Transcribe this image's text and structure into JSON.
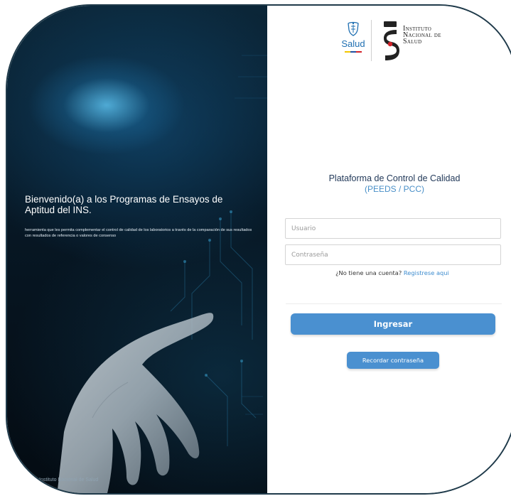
{
  "left_panel": {
    "welcome_title": "Bienvenido(a) a los Programas de Ensayos de Aptitud del INS.",
    "welcome_description": "herramienta que les permita complementar el control de calidad de los laboratorios a través de la comparación de sus resultados con resultados de referencia o valores de consenso",
    "footer": "Instituto Nacional de Salud"
  },
  "logos": {
    "salud_label": "Salud",
    "ins_line1": "Instituto",
    "ins_line2": "Nacional de",
    "ins_line3": "Salud"
  },
  "login": {
    "title": "Plataforma de Control de Calidad",
    "subtitle": "(PEEDS / PCC)",
    "user_placeholder": "Usuario",
    "password_placeholder": "Contraseña",
    "no_account_text": "¿No tiene una cuenta?",
    "register_link": "Registrese aqui",
    "submit_label": "Ingresar",
    "remember_label": "Recordar contraseña"
  },
  "colors": {
    "primary_button": "#4a90d0",
    "link": "#3d8ccf",
    "title": "#233a5a",
    "subtitle": "#4a90c8",
    "salud_blue": "#1f6fb2",
    "flag_yellow": "#f2c500",
    "flag_blue": "#1f4fa0",
    "flag_red": "#d2232a"
  }
}
